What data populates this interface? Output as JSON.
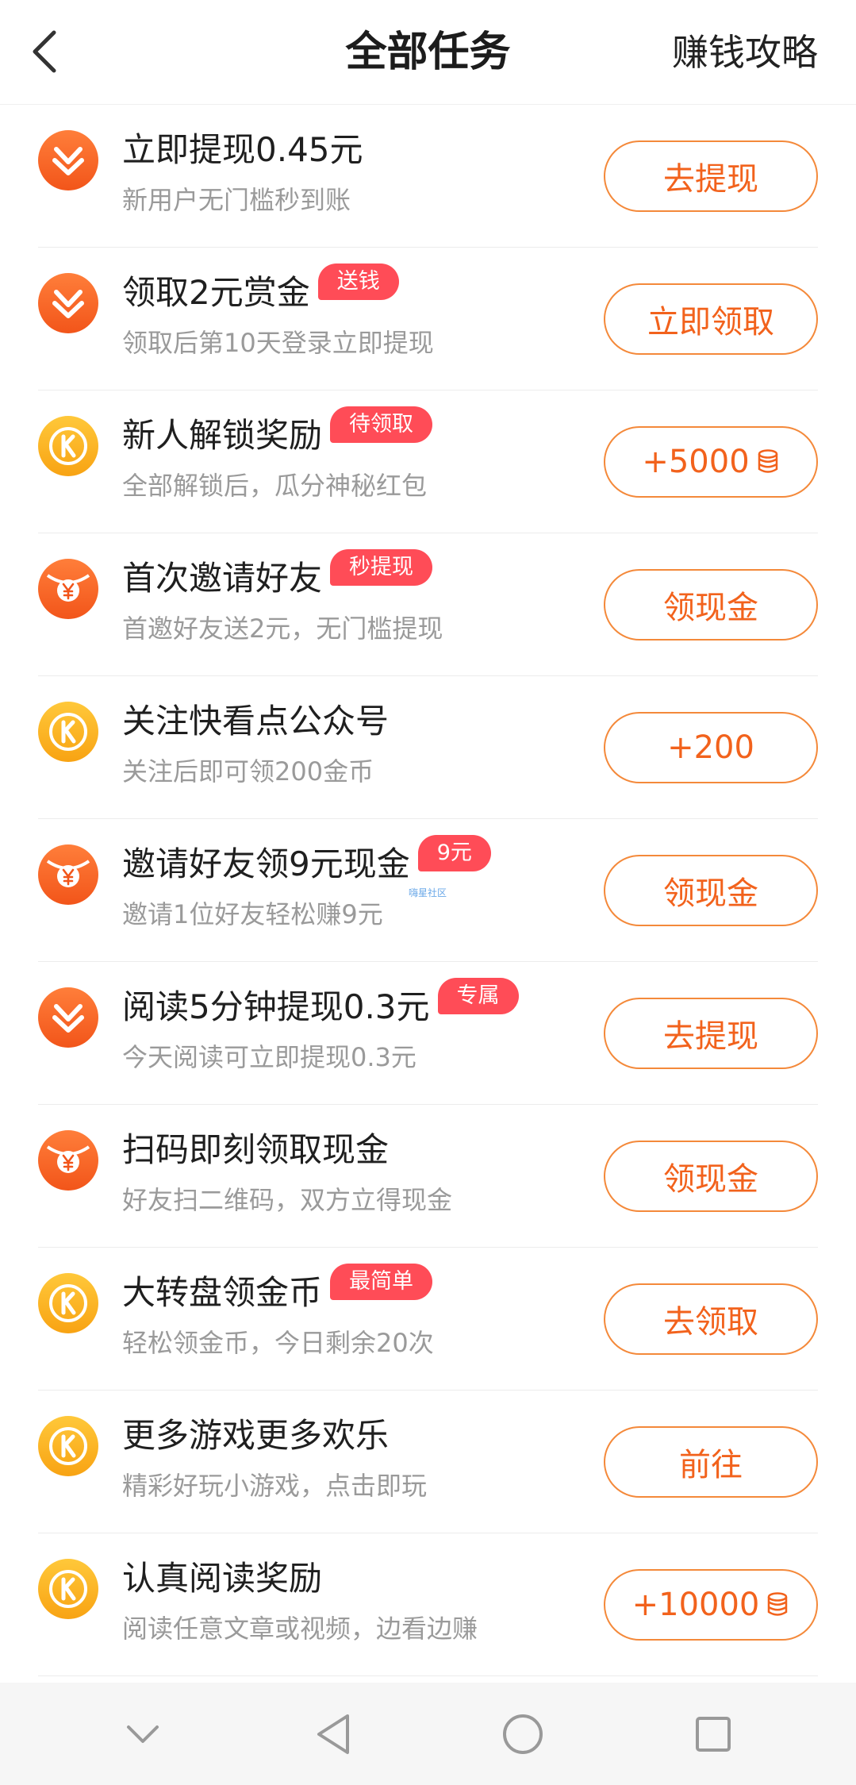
{
  "header": {
    "title": "全部任务",
    "guide_link": "赚钱攻略",
    "back_icon": "chevron-left-icon"
  },
  "colors": {
    "accent": "#f2621c",
    "badge": "#ff4c57",
    "icon_orange": "#f2551a",
    "icon_gold": "#f8a313"
  },
  "tasks": [
    {
      "icon": "withdraw-heart-icon",
      "title": "立即提现0.45元",
      "badge": "",
      "desc": "新用户无门槛秒到账",
      "button": "去提现",
      "coin": false
    },
    {
      "icon": "withdraw-heart-icon",
      "title": "领取2元赏金",
      "badge": "送钱",
      "desc": "领取后第10天登录立即提现",
      "button": "立即领取",
      "coin": false
    },
    {
      "icon": "k-coin-icon",
      "title": "新人解锁奖励",
      "badge": "待领取",
      "desc": "全部解锁后，瓜分神秘红包",
      "button": "+5000",
      "coin": true
    },
    {
      "icon": "yuan-envelope-icon",
      "title": "首次邀请好友",
      "badge": "秒提现",
      "desc": "首邀好友送2元，无门槛提现",
      "button": "领现金",
      "coin": false
    },
    {
      "icon": "k-coin-icon",
      "title": "关注快看点公众号",
      "badge": "",
      "desc": "关注后即可领200金币",
      "button": "+200",
      "coin": false
    },
    {
      "icon": "yuan-envelope-icon",
      "title": "邀请好友领9元现金",
      "badge": "9元",
      "desc": "邀请1位好友轻松赚9元",
      "button": "领现金",
      "coin": false
    },
    {
      "icon": "withdraw-heart-icon",
      "title": "阅读5分钟提现0.3元",
      "badge": "专属",
      "desc": "今天阅读可立即提现0.3元",
      "button": "去提现",
      "coin": false
    },
    {
      "icon": "yuan-envelope-icon",
      "title": "扫码即刻领取现金",
      "badge": "",
      "desc": "好友扫二维码，双方立得现金",
      "button": "领现金",
      "coin": false
    },
    {
      "icon": "k-coin-icon",
      "title": "大转盘领金币",
      "badge": "最简单",
      "desc": "轻松领金币，今日剩余20次",
      "button": "去领取",
      "coin": false
    },
    {
      "icon": "k-coin-icon",
      "title": "更多游戏更多欢乐",
      "badge": "",
      "desc": "精彩好玩小游戏，点击即玩",
      "button": "前往",
      "coin": false
    },
    {
      "icon": "k-coin-icon",
      "title": "认真阅读奖励",
      "badge": "",
      "desc": "阅读任意文章或视频，边看边赚",
      "button": "+10000",
      "coin": true
    }
  ],
  "watermark": "嗨星社区",
  "navbar": {
    "items": [
      "chevron-down-icon",
      "back-triangle-icon",
      "home-circle-icon",
      "recents-square-icon"
    ]
  }
}
